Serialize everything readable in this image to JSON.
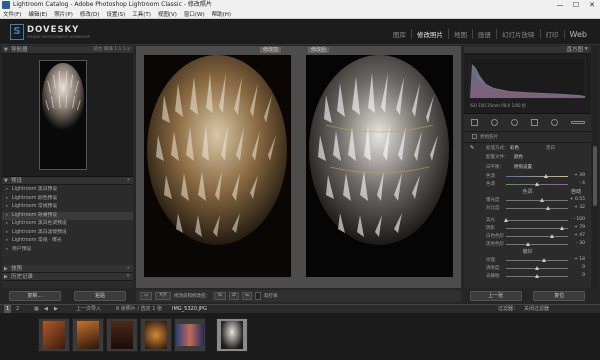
{
  "window": {
    "title": "Lightroom Catalog - Adobe Photoshop Lightroom Classic - 修改照片",
    "min": "—",
    "max": "☐",
    "close": "✕"
  },
  "menu": [
    "文件(F)",
    "编辑(E)",
    "照片(P)",
    "修改(D)",
    "设置(S)",
    "工具(T)",
    "视图(V)",
    "窗口(W)",
    "帮助(H)"
  ],
  "brand": {
    "letter": "S",
    "name": "DOVESKY",
    "tagline": "STUDIO PHOTOGRAPHY WORKSHOP"
  },
  "modules": [
    "图库",
    "修改照片",
    "地图",
    "画册",
    "幻灯片放映",
    "打印",
    "Web"
  ],
  "active_module": "修改照片",
  "left": {
    "navigator": {
      "title": "导航器",
      "zoom": "适合 填满 1:1 1:2"
    },
    "presets": {
      "title": "预设",
      "items": [
        "Lightroom 黑白预设",
        "Lightroom 颜色预设",
        "Lightroom 常规预设",
        "Lightroom 效果预设",
        "Lightroom 黑白色调预设",
        "Lightroom 黑白滤镜预设",
        "Lightroom 常规 · 曝光",
        "用户预设"
      ]
    },
    "snapshots": {
      "title": "快照"
    },
    "history": {
      "title": "历史记录"
    },
    "copy_btn": "复制...",
    "paste_btn": "粘贴"
  },
  "center": {
    "before_label": "修改前",
    "after_label": "修改后",
    "toolbar": {
      "view_mode": "Y|Y",
      "label": "修改前和修改后：",
      "soft_proof": "软打样"
    }
  },
  "right": {
    "histogram": {
      "title": "直方图",
      "info": "ISO 100   35mm   f/8.0   1/60 秒"
    },
    "original": "原始照片",
    "basic": {
      "treatment_label": "处理方式：",
      "color": "彩色",
      "bw": "黑白",
      "profile_label": "配置文件：",
      "profile_value": "颜色",
      "wb_label": "白平衡：",
      "wb_value": "原照设置",
      "temp": {
        "label": "色温",
        "value": "+ 39"
      },
      "tint": {
        "label": "色调",
        "value": "- 4"
      },
      "tone": "色调",
      "auto": "自动",
      "exposure": {
        "label": "曝光度",
        "value": "+ 0.55"
      },
      "contrast": {
        "label": "对比度",
        "value": "+ 32"
      },
      "highlights": {
        "label": "高光",
        "value": "- 100"
      },
      "shadows": {
        "label": "阴影",
        "value": "+ 79"
      },
      "whites": {
        "label": "白色色阶",
        "value": "+ 47"
      },
      "blacks": {
        "label": "黑色色阶",
        "value": "- 30"
      },
      "presence": "偏好",
      "texture": {
        "label": "纹理",
        "value": "+ 18"
      },
      "clarity": {
        "label": "清晰度",
        "value": "0"
      },
      "dehaze": {
        "label": "去朦胧",
        "value": "0"
      }
    },
    "prev_btn": "上一张",
    "reset_btn": "复位"
  },
  "filmstrip": {
    "pages": "1 2",
    "source": "上一次导入",
    "count": "8 张照片 / 选定 1 张",
    "file": "IMG_5320.JPG",
    "filter_label": "过滤器：",
    "filter_value": "关闭过滤器"
  }
}
